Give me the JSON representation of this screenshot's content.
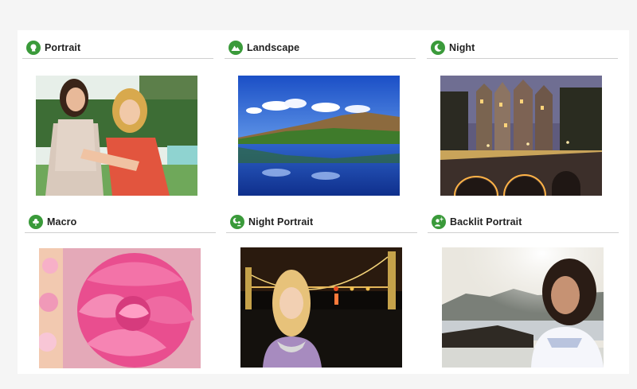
{
  "accent_color": "#3a9a3a",
  "scenes": [
    {
      "id": "portrait",
      "label": "Portrait",
      "icon": "portrait-mode-icon",
      "image": "two-women-smiling-photo"
    },
    {
      "id": "landscape",
      "label": "Landscape",
      "icon": "landscape-mode-icon",
      "image": "lake-reflection-photo"
    },
    {
      "id": "night",
      "label": "Night",
      "icon": "night-mode-icon",
      "image": "canal-bridge-night-photo"
    },
    {
      "id": "macro",
      "label": "Macro",
      "icon": "macro-mode-icon",
      "image": "pink-peony-photo"
    },
    {
      "id": "night-portrait",
      "label": "Night Portrait",
      "icon": "night-portrait-mode-icon",
      "image": "woman-at-night-bridge-photo"
    },
    {
      "id": "backlit-portrait",
      "label": "Backlit Portrait",
      "icon": "backlit-portrait-mode-icon",
      "image": "woman-backlit-seaside-photo"
    }
  ]
}
